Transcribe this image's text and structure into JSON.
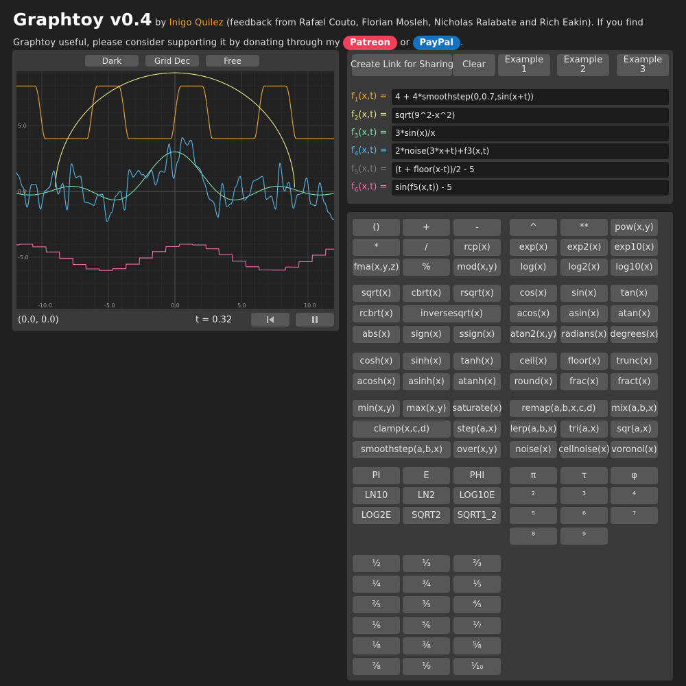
{
  "header": {
    "title": "Graphtoy v0.4",
    "by": " by ",
    "author": "Inigo Quilez",
    "intro_rest": " (feedback from Rafæl Couto, Florian Mosleh, Nicholas Ralabate and Rich Eakin). If you find Graphtoy useful, please consider supporting it by donating through my ",
    "patreon": "Patreon",
    "or": " or ",
    "paypal": "PayPal",
    "end": "."
  },
  "graph": {
    "buttons": {
      "theme": "Dark",
      "grid": "Grid Dec",
      "mode": "Free"
    },
    "coords": "(0.0, 0.0)",
    "time": "t = 0.32",
    "x_ticks": [
      "-10.0",
      "-5.0",
      "0.0",
      "5.0",
      "10.0"
    ],
    "y_ticks": [
      "5.0",
      "0.0",
      "-5.0"
    ],
    "rewind_icon": "skip-to-start-icon",
    "pause_icon": "pause-icon"
  },
  "functions": {
    "buttons": [
      "Create Link for Sharing",
      "Clear",
      "Example 1",
      "Example 2",
      "Example 3"
    ],
    "rows": [
      {
        "name": "f",
        "sub": "1",
        "args": "(x,t) =",
        "expr": "4 + 4*smoothstep(0,0.7,sin(x+t))",
        "color": "#f0a830"
      },
      {
        "name": "f",
        "sub": "2",
        "args": "(x,t) =",
        "expr": "sqrt(9^2-x^2)",
        "color": "#e8e888"
      },
      {
        "name": "f",
        "sub": "3",
        "args": "(x,t) =",
        "expr": "3*sin(x)/x",
        "color": "#7fe0a8"
      },
      {
        "name": "f",
        "sub": "4",
        "args": "(x,t) =",
        "expr": "2*noise(3*x+t)+f3(x,t)",
        "color": "#58b8ea"
      },
      {
        "name": "f",
        "sub": "5",
        "args": "(x,t) =",
        "expr": "(t + floor(x-t))/2 - 5",
        "color": "#7a7a7a"
      },
      {
        "name": "f",
        "sub": "6",
        "args": "(x,t) =",
        "expr": "sin(f5(x,t)) - 5",
        "color": "#f070a8"
      }
    ]
  },
  "keys": {
    "left_groups": [
      [
        "()",
        "+",
        "-",
        "*",
        "/",
        "rcp(x)",
        "fma(x,y,z)",
        "%",
        "mod(x,y)"
      ],
      [
        "sqrt(x)",
        "cbrt(x)",
        "rsqrt(x)",
        "rcbrt(x)",
        "inversesqrt(x)",
        "abs(x)",
        "sign(x)",
        "ssign(x)"
      ],
      [
        "cosh(x)",
        "sinh(x)",
        "tanh(x)",
        "acosh(x)",
        "asinh(x)",
        "atanh(x)"
      ],
      [
        "min(x,y)",
        "max(x,y)",
        "saturate(x)",
        "clamp(x,c,d)",
        "step(a,x)",
        "smoothstep(a,b,x)",
        "over(x,y)"
      ],
      [
        "PI",
        "E",
        "PHI",
        "LN10",
        "LN2",
        "LOG10E",
        "LOG2E",
        "SQRT2",
        "SQRT1_2"
      ],
      [
        "½",
        "⅓",
        "⅔",
        "¼",
        "¾",
        "⅕",
        "⅖",
        "⅗",
        "⅘",
        "⅙",
        "⅚",
        "⅐",
        "⅛",
        "⅜",
        "⅝",
        "⅞",
        "⅑",
        "⅒"
      ]
    ],
    "right_groups": [
      [
        "^",
        "**",
        "pow(x,y)",
        "exp(x)",
        "exp2(x)",
        "exp10(x)",
        "log(x)",
        "log2(x)",
        "log10(x)"
      ],
      [
        "cos(x)",
        "sin(x)",
        "tan(x)",
        "acos(x)",
        "asin(x)",
        "atan(x)",
        "atan2(x,y)",
        "radians(x)",
        "degrees(x)"
      ],
      [
        "ceil(x)",
        "floor(x)",
        "trunc(x)",
        "round(x)",
        "frac(x)",
        "fract(x)"
      ],
      [
        "remap(a,b,x,c,d)",
        "mix(a,b,x)",
        "lerp(a,b,x)",
        "tri(a,x)",
        "sqr(a,x)",
        "noise(x)",
        "cellnoise(x)",
        "voronoi(x)"
      ],
      [
        "π",
        "τ",
        "φ",
        "²",
        "³",
        "⁴",
        "⁵",
        "⁶",
        "⁷",
        "⁸",
        "⁹"
      ]
    ]
  }
}
